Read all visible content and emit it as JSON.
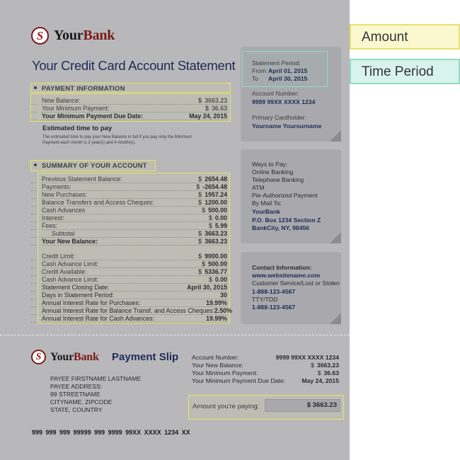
{
  "legend": {
    "amount": "Amount",
    "time_period": "Time Period"
  },
  "brand": {
    "logo_letter": "S",
    "name_part1": "Your",
    "name_part2": "Bank"
  },
  "statement_title": "Your Credit Card Account Statement",
  "payment_info": {
    "heading": "PAYMENT INFORMATION",
    "rows": [
      {
        "label": "New Balance:",
        "currency": "$",
        "value": "3663.23"
      },
      {
        "label": "Your Minimum Payment:",
        "currency": "$",
        "value": "36.63"
      },
      {
        "label": "Your Minimum Payment Due Date:",
        "currency": "",
        "value": "May 24, 2015"
      }
    ]
  },
  "estimated": {
    "heading": "Estimated time to pay",
    "text": "The estimated time to pay your New Balance in full if you pay only the Minimum Payment each month is 2 year(s) and 4 month(s)."
  },
  "summary": {
    "heading": "SUMMARY OF YOUR ACCOUNT",
    "rows": [
      {
        "label": "Previous Statement Balance:",
        "currency": "$",
        "value": "2654.48"
      },
      {
        "label": "Payments:",
        "currency": "$",
        "value": "-2654.48"
      },
      {
        "label": "New Purchases:",
        "currency": "$",
        "value": "1957.24"
      },
      {
        "label": "Balance Transfers and Access Cheques:",
        "currency": "$",
        "value": "1200.00"
      },
      {
        "label": "Cash Advances",
        "currency": "$",
        "value": "500.00"
      },
      {
        "label": "Interest:",
        "currency": "$",
        "value": "0.00"
      },
      {
        "label": "Fees:",
        "currency": "$",
        "value": "5.99"
      },
      {
        "label": "Subtotal",
        "currency": "$",
        "value": "3663.23"
      },
      {
        "label": "Your New Balance:",
        "currency": "$",
        "value": "3663.23"
      },
      {
        "label": "Credit Limit:",
        "currency": "$",
        "value": "9000.00"
      },
      {
        "label": "Cash Advance Limit:",
        "currency": "$",
        "value": "500.00"
      },
      {
        "label": "Credit Available:",
        "currency": "$",
        "value": "5336.77"
      },
      {
        "label": "Cash Advance Limit:",
        "currency": "$",
        "value": "0.00"
      },
      {
        "label": "Statement Closing Date:",
        "currency": "",
        "value": "April 30, 2015"
      },
      {
        "label": "Days in Statement Period:",
        "currency": "",
        "value": "30"
      },
      {
        "label": "Annual Interest Rate for Purchases:",
        "currency": "",
        "value": "19.99%"
      },
      {
        "label": "Annual Interest Rate for Balance Transf. and Access Cheques:",
        "currency": "",
        "value": "2.50%"
      },
      {
        "label": "Annual Interest Rate for Cash Advances:",
        "currency": "",
        "value": "19.99%"
      }
    ]
  },
  "panel1": {
    "period_label": "Statement Period:",
    "from_label": "From",
    "from_date": "April 01, 2015",
    "to_label": "To",
    "to_date": "April 30, 2015",
    "account_label": "Account Number:",
    "account_number": "9999 99XX XXXX 1234",
    "holder_label": "Primary Cardholder:",
    "holder_name": "Yourname Yoursurname"
  },
  "panel2": {
    "heading": "Ways to Pay:",
    "methods": [
      "Online Banking",
      "Telephone Banking",
      "ATM",
      "Pie-Authorized Payment",
      "By Mail To:"
    ],
    "mail_name": "YourBank",
    "mail_line1": "P.O. Box 1234 Section Z",
    "mail_line2": "BankCity, NY, 98456"
  },
  "panel3": {
    "heading": "Contact Information:",
    "website": "www.websitename.com",
    "lost_label": "Customer Service/Lost or Stolen",
    "phone1": "1-888-123-4567",
    "tty_label": "TTY/TDD",
    "phone2": "1-888-123-4567"
  },
  "slip": {
    "title": "Payment Slip",
    "address": [
      "PAYEE FIRSTNAME LASTNAME",
      "PAYEE ADDRESS:",
      "99 STREETNAME",
      "CITYNAME, ZIPCODE",
      "STATE, COUNTRY"
    ],
    "rows": [
      {
        "label": "Account Number:",
        "currency": "",
        "value": "9999 99XX XXXX 1234"
      },
      {
        "label": "Your New Balance:",
        "currency": "$",
        "value": "3663.23"
      },
      {
        "label": "Your Minimum Payment:",
        "currency": "$",
        "value": "36.63"
      },
      {
        "label": "Your Minimum Payment Due Date:",
        "currency": "",
        "value": "May 24, 2015"
      }
    ],
    "paying_label": "Amount you're paying:",
    "paying_value": "$ 3663.23",
    "micr": "999 999 999    99999  999    9999 99XX XXXX 1234    XX"
  }
}
